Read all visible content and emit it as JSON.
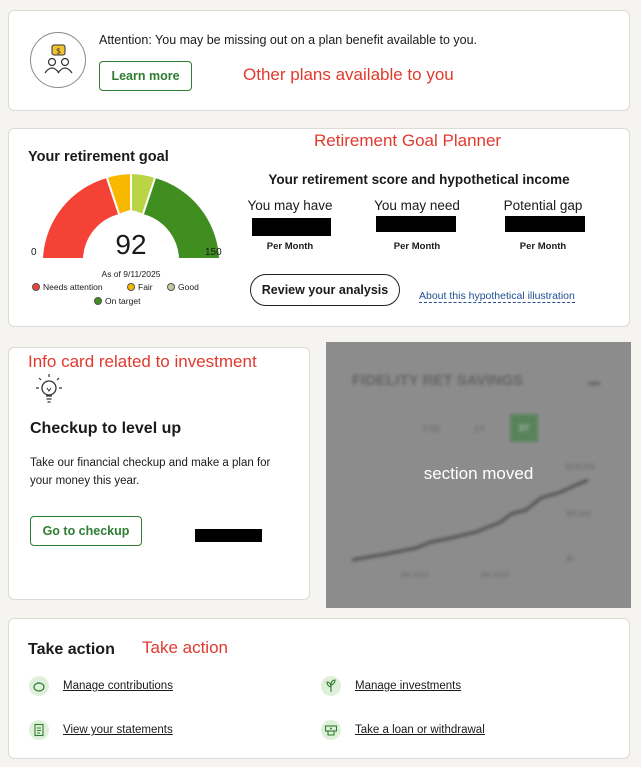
{
  "attention": {
    "message": "Attention: You may be missing out on a plan benefit available to you.",
    "button": "Learn more",
    "note": "Other plans available to you"
  },
  "goal": {
    "title": "Your retirement goal",
    "note": "Retirement Goal Planner",
    "score": "92",
    "gauge_min": "0",
    "gauge_max": "150",
    "as_of": "As of 9/11/2025",
    "legend": [
      "Needs attention",
      "Fair",
      "Good",
      "On target"
    ],
    "subtitle": "Your retirement score and hypothetical income",
    "metrics": [
      {
        "label": "You may have",
        "unit": "Per Month"
      },
      {
        "label": "You may need",
        "unit": "Per Month"
      },
      {
        "label": "Potential gap",
        "unit": "Per Month"
      }
    ],
    "review_button": "Review your analysis",
    "about_link": "About this hypothetical illustration",
    "colors": {
      "needs_attention": "#f44336",
      "fair": "#f9b800",
      "good": "#b9d545",
      "on_target": "#3f8e1f"
    }
  },
  "checkup": {
    "note": "Info card related to investment",
    "title": "Checkup to level up",
    "description": "Take our financial checkup and make a plan for your money this year.",
    "button": "Go to checkup"
  },
  "moved": {
    "label": "section moved",
    "card_title": "FIDELITY RET SAVINGS",
    "ranges": [
      "YTD",
      "1Y",
      "3Y"
    ],
    "y_ticks": [
      "$100,000",
      "$50,000",
      "$0"
    ],
    "x_ticks": [
      "Jan 2024",
      "Jan 2025"
    ]
  },
  "action": {
    "title": "Take action",
    "note": "Take action",
    "items": [
      {
        "label": "Manage contributions",
        "icon": "piggy-bank-icon"
      },
      {
        "label": "Manage investments",
        "icon": "plant-icon"
      },
      {
        "label": "View your statements",
        "icon": "document-icon"
      },
      {
        "label": "Take a loan or withdrawal",
        "icon": "cash-icon"
      }
    ]
  }
}
